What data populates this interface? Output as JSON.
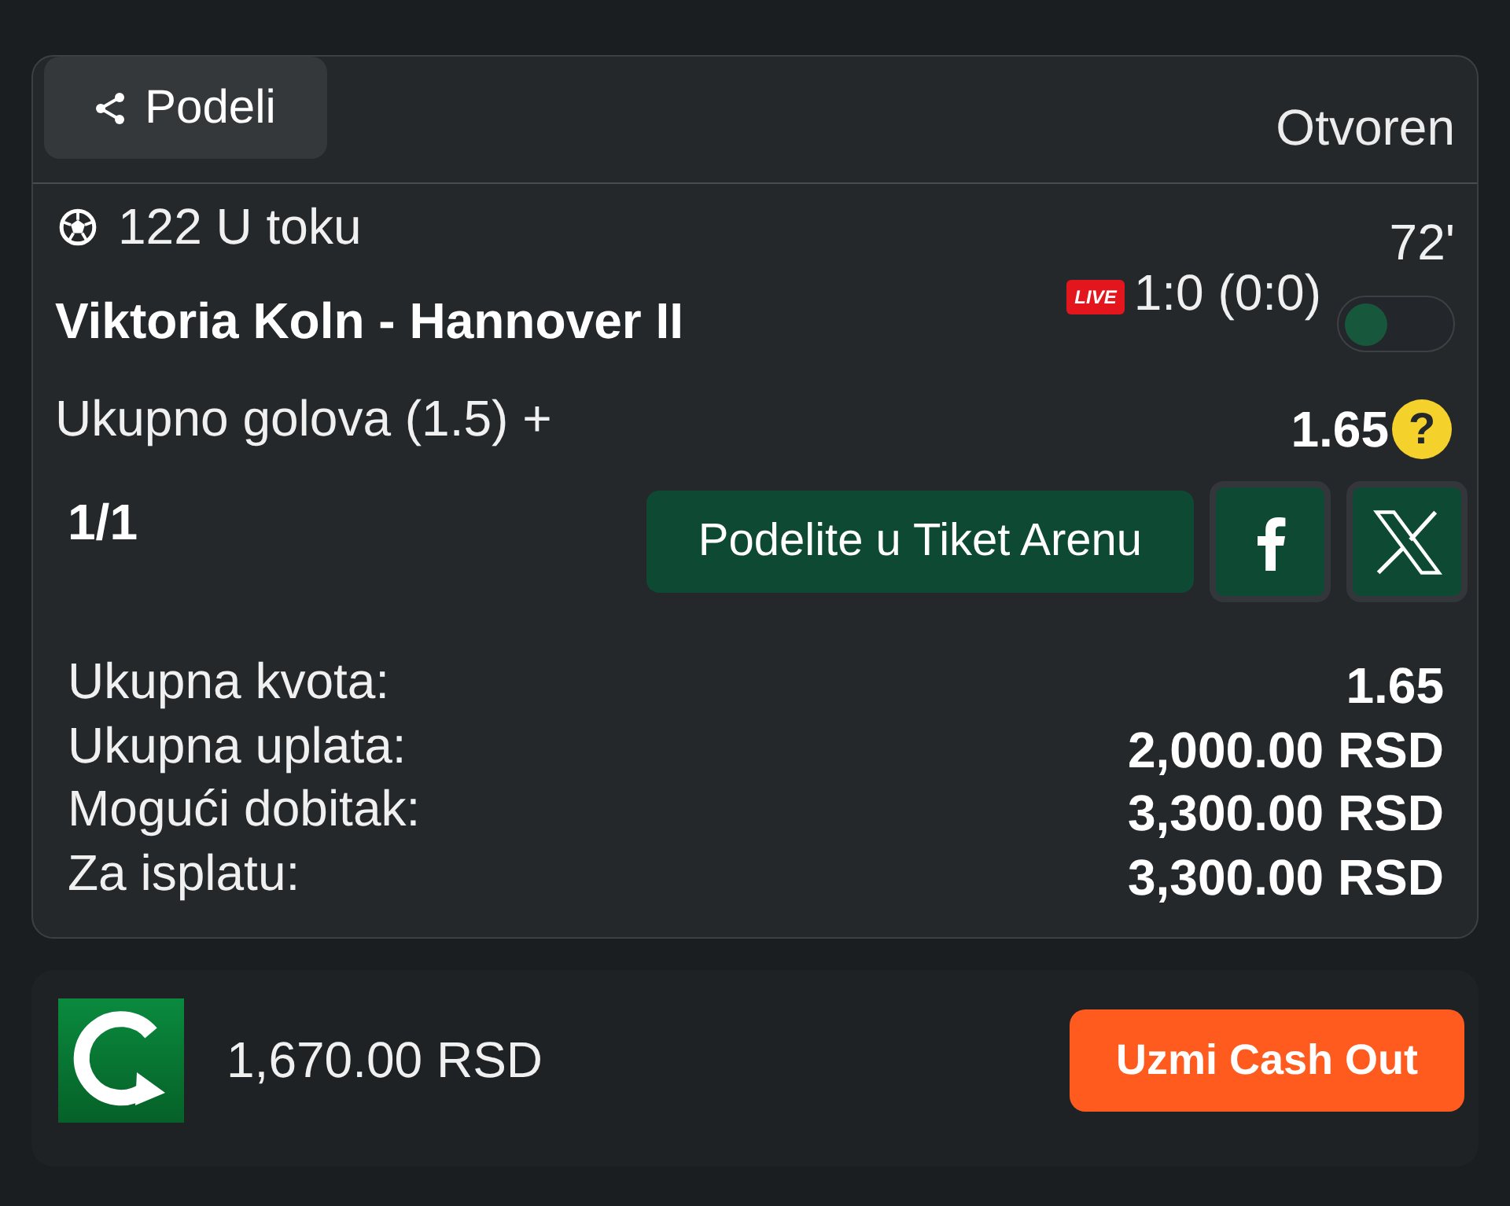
{
  "header": {
    "share_button": "Podeli",
    "status": "Otvoren"
  },
  "event": {
    "status": "122 U toku",
    "minute": "72'",
    "match": "Viktoria Koln - Hannover II",
    "live_badge": "LIVE",
    "score": "1:0 (0:0)",
    "toggle": {
      "on": false
    }
  },
  "selection": {
    "market": "Ukupno golova (1.5) +",
    "odds": "1.65",
    "help": "?"
  },
  "ticket": {
    "count": "1/1",
    "arena_button": "Podelite u Tiket Arenu"
  },
  "summary": [
    {
      "label": "Ukupna kvota:",
      "value": "1.65"
    },
    {
      "label": "Ukupna uplata:",
      "value": "2,000.00 RSD"
    },
    {
      "label": "Mogući dobitak:",
      "value": "3,300.00 RSD"
    },
    {
      "label": "Za isplatu:",
      "value": "3,300.00 RSD"
    }
  ],
  "cashout": {
    "amount": "1,670.00 RSD",
    "button": "Uzmi Cash Out"
  }
}
